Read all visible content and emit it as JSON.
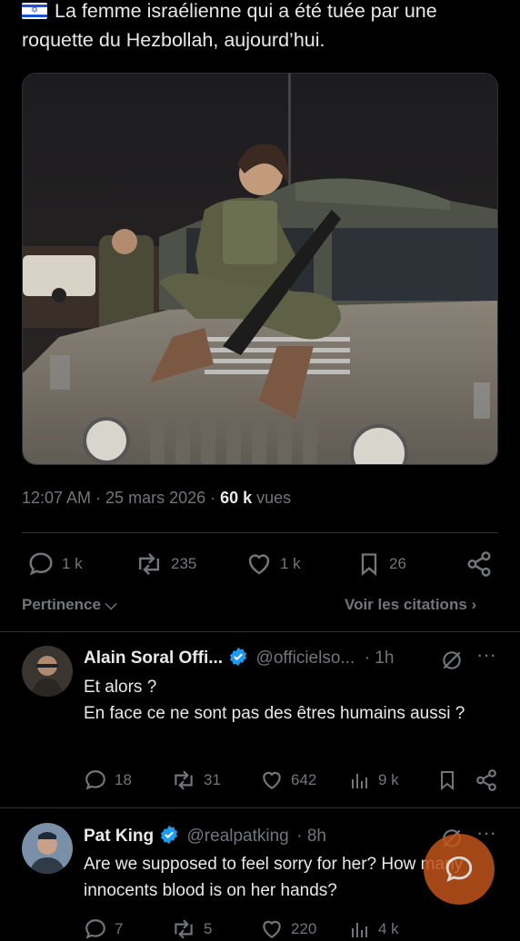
{
  "post": {
    "text": "La femme israélienne qui a été tuée par une roquette du Hezbollah, aujourd’hui.",
    "time": "12:07 AM · 25 mars 2026 · ",
    "views_count": "60 k",
    "views_label": " vues"
  },
  "actions": {
    "replies": "1 k",
    "reposts": "235",
    "likes": "1 k",
    "bookmarks": "26"
  },
  "sort": {
    "relevance": "Pertinence",
    "quotes": "Voir les citations"
  },
  "replies": [
    {
      "name": "Alain Soral Offi...",
      "handle": "@officielso...",
      "time": "· 1h",
      "text1": "Et alors ?",
      "text2": "En face ce ne sont pas des êtres humains aussi ?",
      "replies": "18",
      "reposts": "31",
      "likes": "642",
      "views": "9 k"
    },
    {
      "name": "Pat King",
      "handle": "@realpatking",
      "time": "· 8h",
      "text": "Are we supposed to feel sorry for her? How many innocents blood is on her hands?",
      "replies": "7",
      "reposts": "5",
      "likes": "220",
      "views": "4 k"
    }
  ],
  "colors": {
    "accent": "#1d9bf0",
    "background": "#000000",
    "muted": "#71767b",
    "fab": "#c1541a"
  }
}
